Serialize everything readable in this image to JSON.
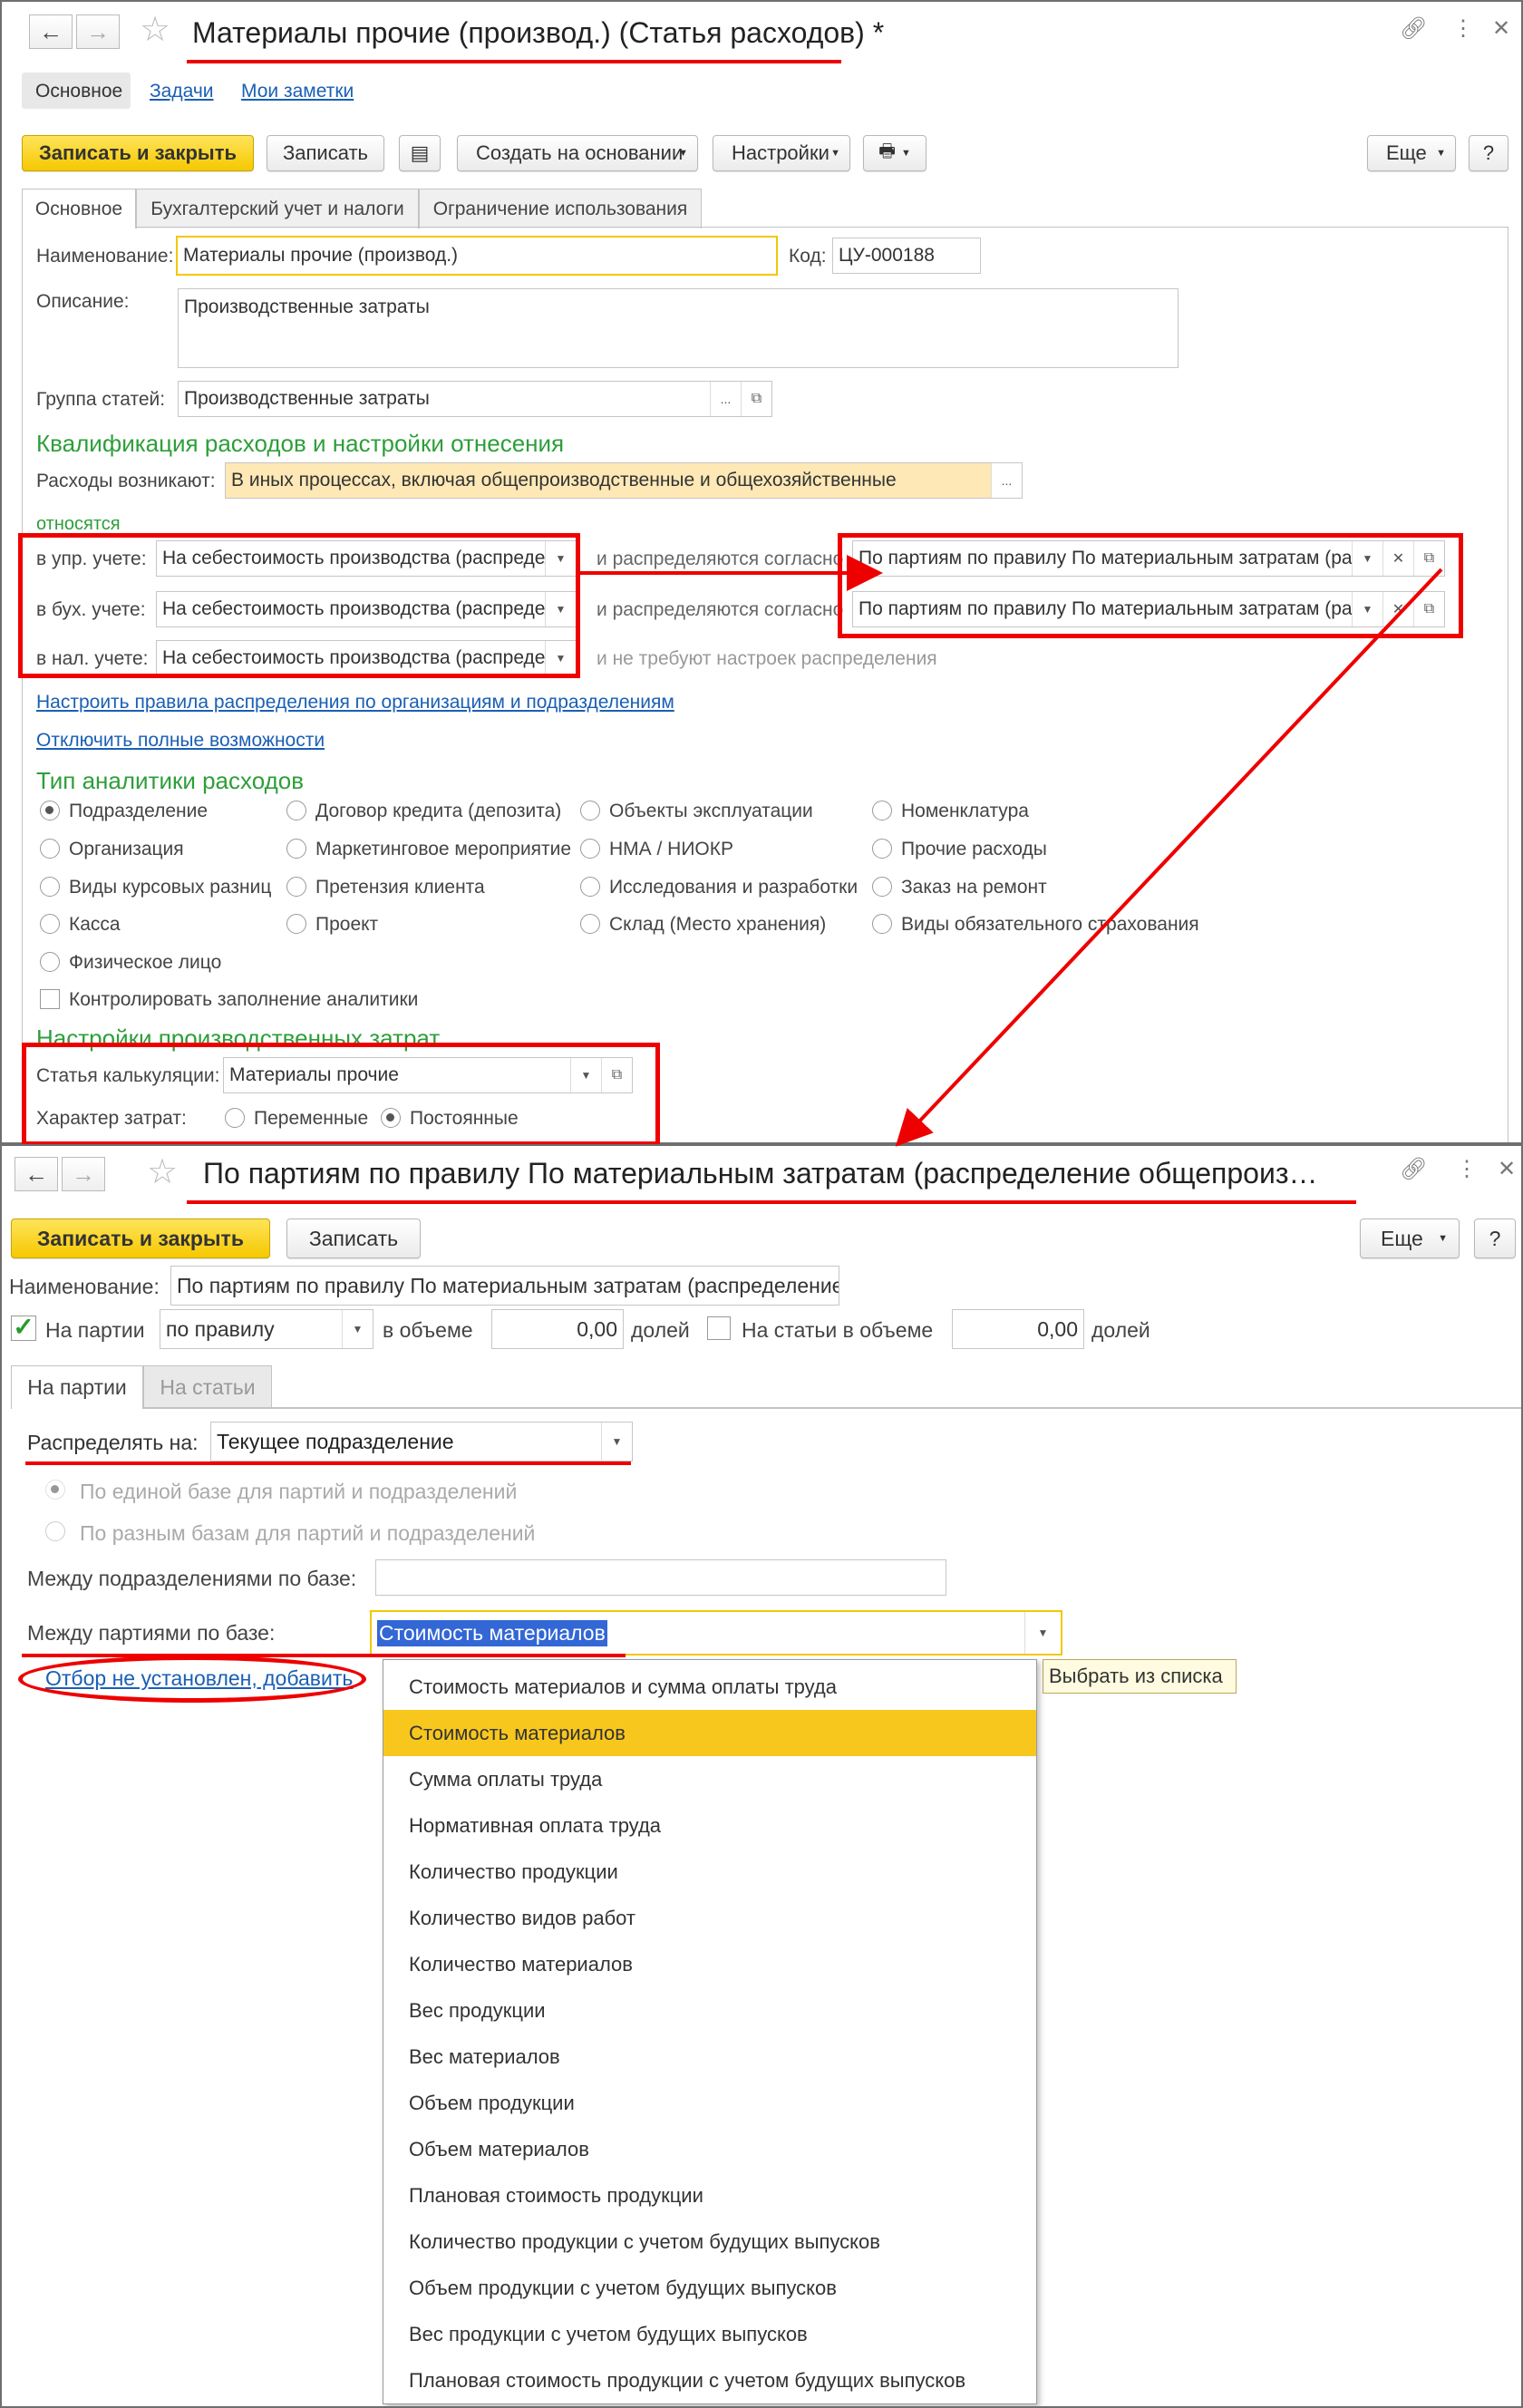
{
  "window1": {
    "title": "Материалы прочие (производ.) (Статья расходов) *",
    "nav_tabs": [
      "Основное",
      "Задачи",
      "Мои заметки"
    ],
    "toolbar": {
      "save_close": "Записать и закрыть",
      "save": "Записать",
      "create_based": "Создать на основании",
      "settings": "Настройки",
      "more": "Еще",
      "help": "?"
    },
    "tabs": [
      "Основное",
      "Бухгалтерский учет и налоги",
      "Ограничение использования"
    ],
    "name_label": "Наименование:",
    "name_value": "Материалы прочие (производ.)",
    "code_label": "Код:",
    "code_value": "ЦУ-000188",
    "desc_label": "Описание:",
    "desc_value": "Производственные затраты",
    "group_label": "Группа статей:",
    "group_value": "Производственные затраты",
    "qual_header": "Квалификация расходов и настройки отнесения",
    "arise_label": "Расходы возникают:",
    "arise_value": "В иных процессах, включая общепроизводственные и общехозяйственные",
    "relate_label": "относятся",
    "rows": [
      {
        "label": "в упр. учете:",
        "value": "На себестоимость производства (распределяются)",
        "mid": "и распределяются согласно",
        "dist": "По партиям по правилу По материальным затратам (распределение)"
      },
      {
        "label": "в бух. учете:",
        "value": "На себестоимость производства (распределяются)",
        "mid": "и распределяются согласно",
        "dist": "По партиям по правилу По материальным затратам (распределение)"
      },
      {
        "label": "в нал. учете:",
        "value": "На себестоимость производства (распределяются)",
        "mid": "и не требуют настроек распределения",
        "dist": ""
      }
    ],
    "link_rules": "Настроить правила распределения по организациям и подразделениям",
    "link_disable": "Отключить полные возможности",
    "analytics_header": "Тип аналитики расходов",
    "analytics": [
      [
        "Подразделение",
        "Договор кредита (депозита)",
        "Объекты эксплуатации",
        "Номенклатура"
      ],
      [
        "Организация",
        "Маркетинговое мероприятие",
        "НМА / НИОКР",
        "Прочие расходы"
      ],
      [
        "Виды курсовых разниц",
        "Претензия клиента",
        "Исследования и разработки",
        "Заказ на ремонт"
      ],
      [
        "Касса",
        "Проект",
        "Склад (Место хранения)",
        "Виды обязательного страхования"
      ],
      [
        "Физическое лицо",
        "",
        "",
        ""
      ]
    ],
    "control_fill": "Контролировать заполнение аналитики",
    "prod_header": "Настройки производственных затрат",
    "calc_label": "Статья калькуляции:",
    "calc_value": "Материалы прочие",
    "nature_label": "Характер затрат:",
    "nature_options": [
      "Переменные",
      "Постоянные"
    ]
  },
  "window2": {
    "title": "По партиям по правилу По материальным затратам (распределение общепроиз…",
    "toolbar": {
      "save_close": "Записать и закрыть",
      "save": "Записать",
      "more": "Еще",
      "help": "?"
    },
    "name_label": "Наименование:",
    "name_value": "По партиям по правилу По материальным затратам (распределение)",
    "by_batches": "На партии",
    "rule_value": "по правилу",
    "in_volume": "в объеме",
    "volume1": "0,00",
    "shares": "долей",
    "by_items": "На статьи в объеме",
    "volume2": "0,00",
    "shares2": "долей",
    "tabs": [
      "На партии",
      "На статьи"
    ],
    "distribute_label": "Распределять на:",
    "distribute_value": "Текущее подразделение",
    "opt_single": "По единой базе для партий и подразделений",
    "opt_diff": "По разным базам для партий и подразделений",
    "between_depts": "Между подразделениями по базе:",
    "between_batches": "Между партиями по базе:",
    "base_value": "Стоимость материалов",
    "filter_link": "Отбор не установлен, добавить",
    "tooltip": "Выбрать из списка",
    "options": [
      "Стоимость материалов и сумма оплаты труда",
      "Стоимость материалов",
      "Сумма оплаты труда",
      "Нормативная оплата труда",
      "Количество продукции",
      "Количество видов работ",
      "Количество материалов",
      "Вес продукции",
      "Вес материалов",
      "Объем продукции",
      "Объем материалов",
      "Плановая стоимость продукции",
      "Количество продукции с учетом будущих выпусков",
      "Объем продукции с учетом будущих выпусков",
      "Вес продукции с учетом будущих выпусков",
      "Плановая стоимость продукции с учетом будущих выпусков"
    ],
    "selected_index": 1
  },
  "colors": {
    "accent_yellow": "#f5c800",
    "highlight_red": "#e00000",
    "group_green": "#2e9e3a",
    "link_blue": "#1a5fb4",
    "selected_item": "#f7c71e"
  }
}
